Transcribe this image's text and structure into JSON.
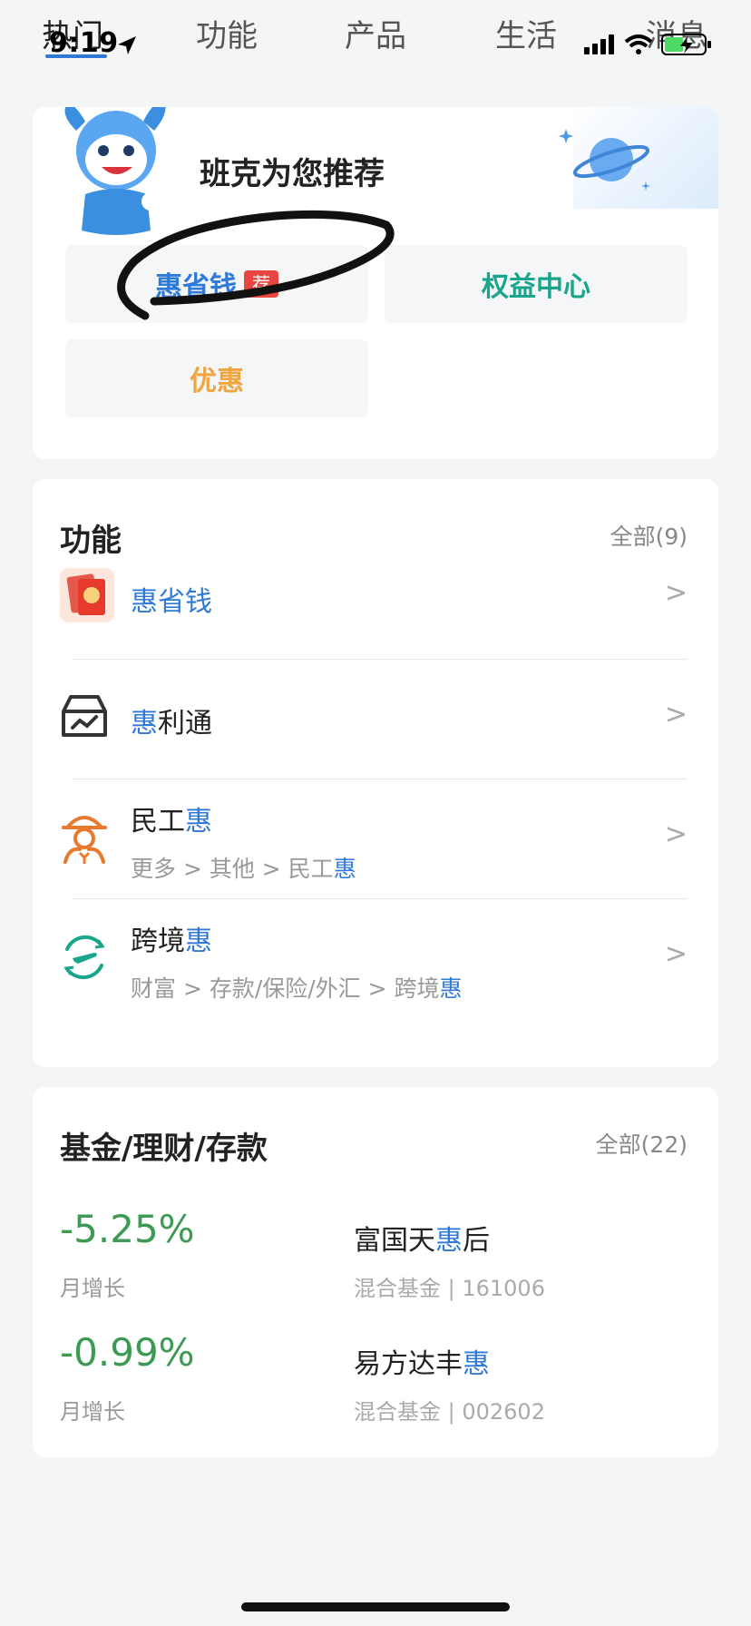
{
  "status_bar": {
    "time": "9:19"
  },
  "tabs": [
    {
      "label": "热门"
    },
    {
      "label": "功能"
    },
    {
      "label": "产品"
    },
    {
      "label": "生活"
    },
    {
      "label": "消息"
    }
  ],
  "recommend": {
    "title": "班克为您推荐",
    "chips": [
      {
        "label": "惠省钱",
        "badge": "荐"
      },
      {
        "label": "权益中心"
      },
      {
        "label": "优惠"
      }
    ]
  },
  "functions": {
    "title": "功能",
    "more": "全部(9)",
    "items": [
      {
        "pre": "",
        "hl": "惠",
        "post": "省钱"
      },
      {
        "pre": "",
        "hl": "惠",
        "post": "利通"
      },
      {
        "pre": "民工",
        "hl": "惠",
        "post": "",
        "path_pre": "更多 > 其他 > 民工",
        "path_hl": "惠"
      },
      {
        "pre": "跨境",
        "hl": "惠",
        "post": "",
        "path_pre": "财富 > 存款/保险/外汇 > 跨境",
        "path_hl": "惠"
      }
    ],
    "chevron": ">"
  },
  "funds": {
    "title": "基金/理财/存款",
    "more": "全部(22)",
    "items": [
      {
        "pct": "-5.25%",
        "pct_label": "月增长",
        "name_pre": "富国天",
        "name_hl": "惠",
        "name_post": "后",
        "code": "混合基金 | 161006"
      },
      {
        "pct": "-0.99%",
        "pct_label": "月增长",
        "name_pre": "易方达丰",
        "name_hl": "惠",
        "name_post": "",
        "code": "混合基金 | 002602"
      }
    ]
  },
  "colors": {
    "accent_blue": "#2f7ad8",
    "teal": "#18a58b",
    "orange": "#f0a540",
    "green": "#3c9a55",
    "badge_red": "#e9463f"
  }
}
